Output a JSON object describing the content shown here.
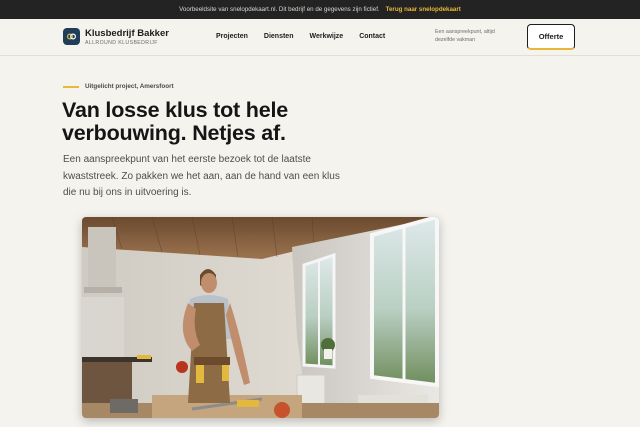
{
  "topbar": {
    "notice": "Voorbeeldsite van snelopdekaart.nl. Dit bedrijf en de gegevens zijn fictief.",
    "back_link": "Terug naar snelopdekaart"
  },
  "header": {
    "brand_name": "Klusbedrijf Bakker",
    "brand_sub": "ALLROUND KLUSBEDRIJF",
    "logo_icon": "circle-link-icon",
    "nav": [
      "Projecten",
      "Diensten",
      "Werkwijze",
      "Contact"
    ],
    "aside_note": "Een aanspreekpunt, altijd dezelfde vakman",
    "cta_label": "Offerte"
  },
  "hero": {
    "eyebrow": "Uitgelicht project, Amersfoort",
    "headline": "Van losse klus tot hele verbouwing. Netjes af.",
    "lead": "Een aanspreekpunt van het eerste bezoek tot de laatste kwaststreek. Zo pakken we het aan, aan de hand van een klus die nu bij ons in uitvoering is."
  },
  "colors": {
    "accent": "#e9b83a",
    "logo_bg": "#1f3e5a",
    "background": "#f5f3ee",
    "topbar_bg": "#232323"
  }
}
